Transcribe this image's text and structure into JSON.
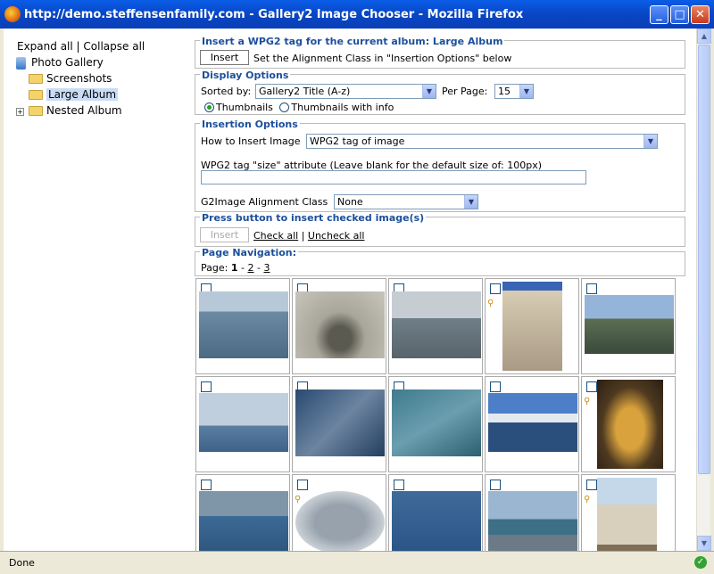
{
  "window": {
    "title": "http://demo.steffensenfamily.com - Gallery2 Image Chooser - Mozilla Firefox",
    "min": "_",
    "max": "□",
    "close": "✕"
  },
  "tree": {
    "expand_all": "Expand all",
    "sep": "|",
    "collapse_all": "Collapse all",
    "root": "Photo Gallery",
    "items": [
      "Screenshots",
      "Large Album",
      "Nested Album"
    ],
    "selected": "Large Album"
  },
  "insert_album": {
    "legend": "Insert a WPG2 tag for the current album: Large Album",
    "button": "Insert",
    "hint": "Set the Alignment Class in \"Insertion Options\" below"
  },
  "display": {
    "legend": "Display Options",
    "sorted_by_label": "Sorted by:",
    "sorted_by_value": "Gallery2 Title (A-z)",
    "per_page_label": "Per Page:",
    "per_page_value": "15",
    "radio_thumbs": "Thumbnails",
    "radio_thumbs_info": "Thumbnails with info"
  },
  "insertion": {
    "legend": "Insertion Options",
    "how_label": "How to Insert Image",
    "how_value": "WPG2 tag of image",
    "size_label": "WPG2 tag \"size\" attribute (Leave blank for the default size of: 100px)",
    "size_value": "",
    "align_label": "G2Image Alignment Class",
    "align_value": "None"
  },
  "insert_checked": {
    "legend": "Press button to insert checked image(s)",
    "button": "Insert",
    "check_all": "Check all",
    "sep": "|",
    "uncheck_all": "Uncheck all"
  },
  "page_nav": {
    "legend": "Page Navigation:",
    "label": "Page:",
    "current": "1",
    "dash": "-",
    "p2": "2",
    "p3": "3"
  },
  "status": {
    "text": "Done"
  }
}
